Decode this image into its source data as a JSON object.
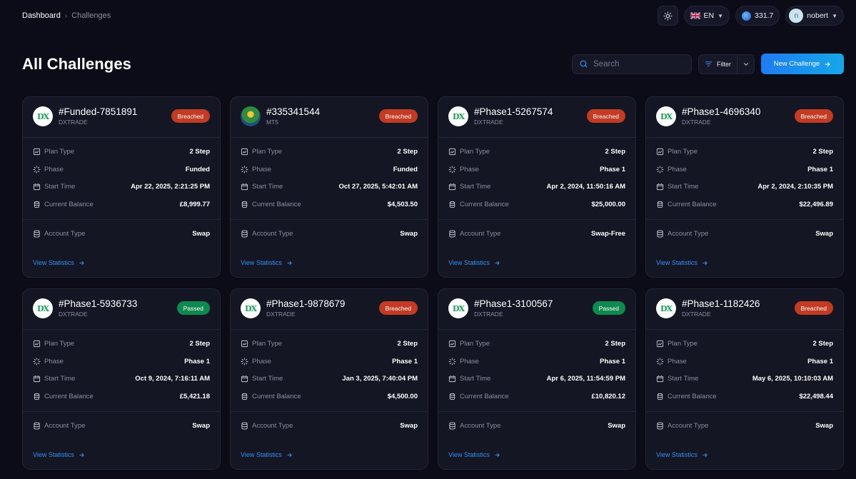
{
  "breadcrumb": {
    "home": "Dashboard",
    "separator": "›",
    "current": "Challenges"
  },
  "topbar": {
    "language": "EN",
    "points": "331.7",
    "username": "nobert",
    "avatar_initial": "n"
  },
  "page": {
    "title": "All Challenges"
  },
  "search": {
    "placeholder": "Search"
  },
  "filter": {
    "label": "Filter"
  },
  "new_challenge": {
    "label": "New Challenge"
  },
  "labels": {
    "plan_type": "Plan Type",
    "phase": "Phase",
    "start_time": "Start Time",
    "current_balance": "Current Balance",
    "account_type": "Account Type",
    "view_statistics": "View Statistics"
  },
  "colors": {
    "breached": "#c23b22",
    "passed": "#0f8a4e",
    "accent": "#1f7cf0",
    "link": "#2f92f5"
  },
  "cards": [
    {
      "id": "#Funded-7851891",
      "platform": "DXTRADE",
      "logo": "DX",
      "status": "Breached",
      "status_key": "breached",
      "plan_type": "2 Step",
      "phase": "Funded",
      "start_time": "Apr 22, 2025, 2:21:25 PM",
      "balance": "£8,999.77",
      "account_type": "Swap"
    },
    {
      "id": "#335341544",
      "platform": "MT5",
      "logo": "",
      "status": "Breached",
      "status_key": "breached",
      "plan_type": "2 Step",
      "phase": "Funded",
      "start_time": "Oct 27, 2025, 5:42:01 AM",
      "balance": "$4,503.50",
      "account_type": "Swap"
    },
    {
      "id": "#Phase1-5267574",
      "platform": "DXTRADE",
      "logo": "DX",
      "status": "Breached",
      "status_key": "breached",
      "plan_type": "2 Step",
      "phase": "Phase 1",
      "start_time": "Apr 2, 2024, 11:50:16 AM",
      "balance": "$25,000.00",
      "account_type": "Swap-Free"
    },
    {
      "id": "#Phase1-4696340",
      "platform": "DXTRADE",
      "logo": "DX",
      "status": "Breached",
      "status_key": "breached",
      "plan_type": "2 Step",
      "phase": "Phase 1",
      "start_time": "Apr 2, 2024, 2:10:35 PM",
      "balance": "$22,496.89",
      "account_type": "Swap"
    },
    {
      "id": "#Phase1-5936733",
      "platform": "DXTRADE",
      "logo": "DX",
      "status": "Passed",
      "status_key": "passed",
      "plan_type": "2 Step",
      "phase": "Phase 1",
      "start_time": "Oct 9, 2024, 7:16:11 AM",
      "balance": "£5,421.18",
      "account_type": "Swap"
    },
    {
      "id": "#Phase1-9878679",
      "platform": "DXTRADE",
      "logo": "DX",
      "status": "Breached",
      "status_key": "breached",
      "plan_type": "2 Step",
      "phase": "Phase 1",
      "start_time": "Jan 3, 2025, 7:40:04 PM",
      "balance": "$4,500.00",
      "account_type": "Swap"
    },
    {
      "id": "#Phase1-3100567",
      "platform": "DXTRADE",
      "logo": "DX",
      "status": "Passed",
      "status_key": "passed",
      "plan_type": "2 Step",
      "phase": "Phase 1",
      "start_time": "Apr 6, 2025, 11:54:59 PM",
      "balance": "£10,820.12",
      "account_type": "Swap"
    },
    {
      "id": "#Phase1-1182426",
      "platform": "DXTRADE",
      "logo": "DX",
      "status": "Breached",
      "status_key": "breached",
      "plan_type": "2 Step",
      "phase": "Phase 1",
      "start_time": "May 6, 2025, 10:10:03 AM",
      "balance": "$22,498.44",
      "account_type": "Swap"
    }
  ]
}
